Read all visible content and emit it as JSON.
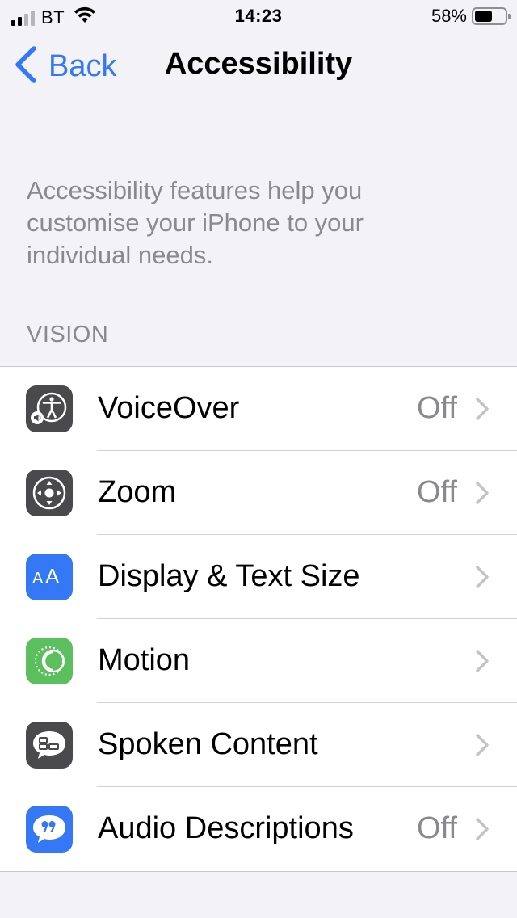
{
  "status_bar": {
    "carrier": "BT",
    "time": "14:23",
    "battery_percent": "58%",
    "battery_level": 0.58
  },
  "nav": {
    "back_label": "Back",
    "title": "Accessibility"
  },
  "description": "Accessibility features help you customise your iPhone to your individual needs.",
  "section_header": "VISION",
  "colors": {
    "accent": "#3478f6",
    "icon_dark": "#4a4a4d",
    "icon_blue": "#3478f6",
    "icon_green": "#5bbf5e"
  },
  "items": [
    {
      "label": "VoiceOver",
      "value": "Off",
      "icon": "voiceover-icon"
    },
    {
      "label": "Zoom",
      "value": "Off",
      "icon": "zoom-icon"
    },
    {
      "label": "Display & Text Size",
      "value": "",
      "icon": "display-text-size-icon"
    },
    {
      "label": "Motion",
      "value": "",
      "icon": "motion-icon"
    },
    {
      "label": "Spoken Content",
      "value": "",
      "icon": "spoken-content-icon"
    },
    {
      "label": "Audio Descriptions",
      "value": "Off",
      "icon": "audio-descriptions-icon"
    }
  ]
}
